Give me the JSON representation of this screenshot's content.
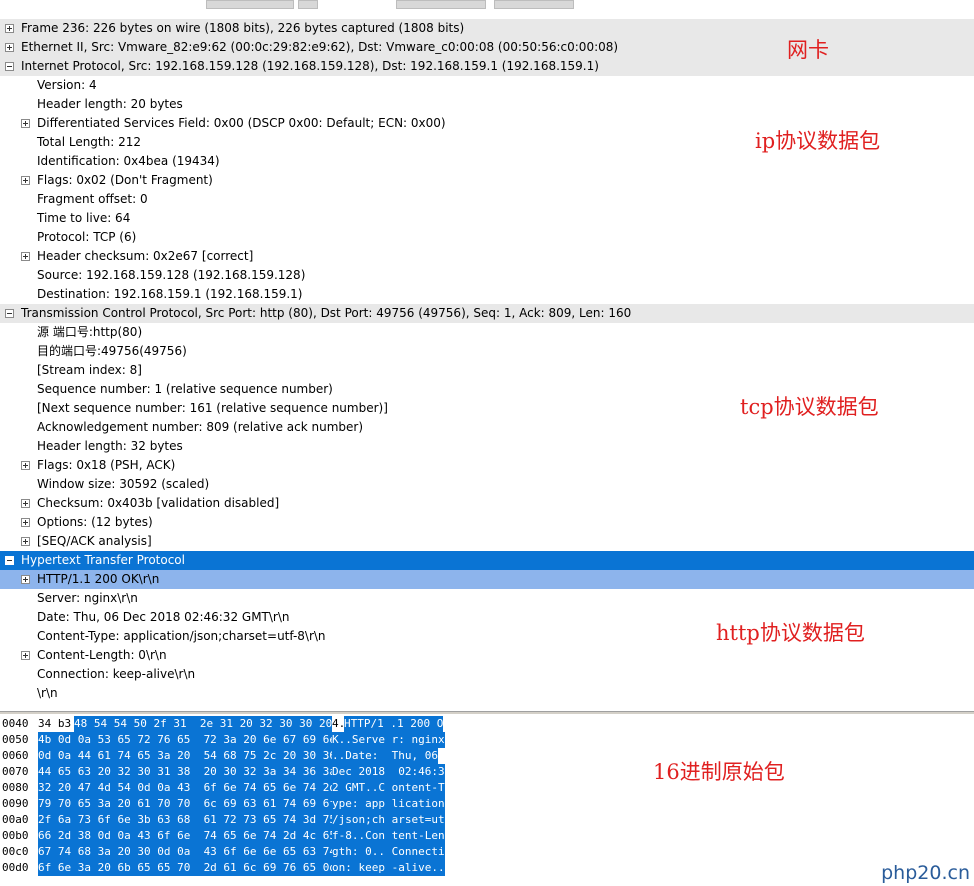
{
  "tree": [
    {
      "text": "Frame 236: 226 bytes on wire (1808 bits), 226 bytes captured (1808 bits)",
      "indent": 0,
      "expander": "plus",
      "style": "hdr"
    },
    {
      "text": "Ethernet II, Src: Vmware_82:e9:62 (00:0c:29:82:e9:62), Dst: Vmware_c0:00:08 (00:50:56:c0:00:08)",
      "indent": 0,
      "expander": "plus",
      "style": "hdr"
    },
    {
      "text": "Internet Protocol, Src: 192.168.159.128 (192.168.159.128), Dst: 192.168.159.1 (192.168.159.1)",
      "indent": 0,
      "expander": "minus",
      "style": "hdr"
    },
    {
      "text": "Version: 4",
      "indent": 1,
      "expander": "none",
      "style": ""
    },
    {
      "text": "Header length: 20 bytes",
      "indent": 1,
      "expander": "none",
      "style": ""
    },
    {
      "text": "Differentiated Services Field: 0x00 (DSCP 0x00: Default; ECN: 0x00)",
      "indent": 1,
      "expander": "plus",
      "style": ""
    },
    {
      "text": "Total Length: 212",
      "indent": 1,
      "expander": "none",
      "style": ""
    },
    {
      "text": "Identification: 0x4bea (19434)",
      "indent": 1,
      "expander": "none",
      "style": ""
    },
    {
      "text": "Flags: 0x02 (Don't Fragment)",
      "indent": 1,
      "expander": "plus",
      "style": ""
    },
    {
      "text": "Fragment offset: 0",
      "indent": 1,
      "expander": "none",
      "style": ""
    },
    {
      "text": "Time to live: 64",
      "indent": 1,
      "expander": "none",
      "style": ""
    },
    {
      "text": "Protocol: TCP (6)",
      "indent": 1,
      "expander": "none",
      "style": ""
    },
    {
      "text": "Header checksum: 0x2e67 [correct]",
      "indent": 1,
      "expander": "plus",
      "style": ""
    },
    {
      "text": "Source: 192.168.159.128 (192.168.159.128)",
      "indent": 1,
      "expander": "none",
      "style": ""
    },
    {
      "text": "Destination: 192.168.159.1 (192.168.159.1)",
      "indent": 1,
      "expander": "none",
      "style": ""
    },
    {
      "text": "Transmission Control Protocol, Src Port: http (80), Dst Port: 49756 (49756), Seq: 1, Ack: 809, Len: 160",
      "indent": 0,
      "expander": "minus",
      "style": "hdr"
    },
    {
      "text": "源  端口号:http(80)",
      "indent": 1,
      "expander": "none",
      "style": ""
    },
    {
      "text": "目的端口号:49756(49756)",
      "indent": 1,
      "expander": "none",
      "style": ""
    },
    {
      "text": "[Stream index: 8]",
      "indent": 1,
      "expander": "none",
      "style": ""
    },
    {
      "text": "Sequence number: 1    (relative sequence number)",
      "indent": 1,
      "expander": "none",
      "style": ""
    },
    {
      "text": "[Next sequence number: 161    (relative sequence number)]",
      "indent": 1,
      "expander": "none",
      "style": ""
    },
    {
      "text": "Acknowledgement number: 809    (relative ack number)",
      "indent": 1,
      "expander": "none",
      "style": ""
    },
    {
      "text": "Header length: 32 bytes",
      "indent": 1,
      "expander": "none",
      "style": ""
    },
    {
      "text": "Flags: 0x18 (PSH, ACK)",
      "indent": 1,
      "expander": "plus",
      "style": ""
    },
    {
      "text": "Window size: 30592 (scaled)",
      "indent": 1,
      "expander": "none",
      "style": ""
    },
    {
      "text": "Checksum: 0x403b [validation disabled]",
      "indent": 1,
      "expander": "plus",
      "style": ""
    },
    {
      "text": "Options: (12 bytes)",
      "indent": 1,
      "expander": "plus",
      "style": ""
    },
    {
      "text": "[SEQ/ACK analysis]",
      "indent": 1,
      "expander": "plus",
      "style": ""
    },
    {
      "text": "Hypertext Transfer Protocol",
      "indent": 0,
      "expander": "minus",
      "style": "sel"
    },
    {
      "text": "HTTP/1.1 200 OK\\r\\n",
      "indent": 1,
      "expander": "plus",
      "style": "hl"
    },
    {
      "text": "Server: nginx\\r\\n",
      "indent": 1,
      "expander": "none",
      "style": ""
    },
    {
      "text": "Date: Thu, 06 Dec 2018 02:46:32 GMT\\r\\n",
      "indent": 1,
      "expander": "none",
      "style": ""
    },
    {
      "text": "Content-Type: application/json;charset=utf-8\\r\\n",
      "indent": 1,
      "expander": "none",
      "style": ""
    },
    {
      "text": "Content-Length: 0\\r\\n",
      "indent": 1,
      "expander": "plus",
      "style": ""
    },
    {
      "text": "Connection: keep-alive\\r\\n",
      "indent": 1,
      "expander": "none",
      "style": ""
    },
    {
      "text": "\\r\\n",
      "indent": 1,
      "expander": "none",
      "style": ""
    }
  ],
  "annotations": {
    "nic": "网卡",
    "ip": "ip协议数据包",
    "tcp": "tcp协议数据包",
    "http": "http协议数据包",
    "hex": "16进制原始包"
  },
  "hex": [
    {
      "offset": "0040",
      "pre": "34 b3",
      "bytes": "48 54 54 50 2f 31  2e 31 20 32 30 30 20 4f",
      "ascii_pre": "4.",
      "ascii": "HTTP/1 .1 200 O"
    },
    {
      "offset": "0050",
      "pre": "",
      "bytes": "4b 0d 0a 53 65 72 76 65  72 3a 20 6e 67 69 6e 78",
      "ascii_pre": "",
      "ascii": "K..Serve r: nginx"
    },
    {
      "offset": "0060",
      "pre": "",
      "bytes": "0d 0a 44 61 74 65 3a 20  54 68 75 2c 20 30 36 20",
      "ascii_pre": "",
      "ascii": "..Date:  Thu, 06"
    },
    {
      "offset": "0070",
      "pre": "",
      "bytes": "44 65 63 20 32 30 31 38  20 30 32 3a 34 36 3a 33",
      "ascii_pre": "",
      "ascii": "Dec 2018  02:46:3"
    },
    {
      "offset": "0080",
      "pre": "",
      "bytes": "32 20 47 4d 54 0d 0a 43  6f 6e 74 65 6e 74 2d 54",
      "ascii_pre": "",
      "ascii": "2 GMT..C ontent-T"
    },
    {
      "offset": "0090",
      "pre": "",
      "bytes": "79 70 65 3a 20 61 70 70  6c 69 63 61 74 69 6f 6e",
      "ascii_pre": "",
      "ascii": "ype: app lication"
    },
    {
      "offset": "00a0",
      "pre": "",
      "bytes": "2f 6a 73 6f 6e 3b 63 68  61 72 73 65 74 3d 75 74",
      "ascii_pre": "",
      "ascii": "/json;ch arset=ut"
    },
    {
      "offset": "00b0",
      "pre": "",
      "bytes": "66 2d 38 0d 0a 43 6f 6e  74 65 6e 74 2d 4c 65 6e",
      "ascii_pre": "",
      "ascii": "f-8..Con tent-Len"
    },
    {
      "offset": "00c0",
      "pre": "",
      "bytes": "67 74 68 3a 20 30 0d 0a  43 6f 6e 6e 65 63 74 69",
      "ascii_pre": "",
      "ascii": "gth: 0.. Connecti"
    },
    {
      "offset": "00d0",
      "pre": "",
      "bytes": "6f 6e 3a 20 6b 65 65 70  2d 61 6c 69 76 65 0d 0a",
      "ascii_pre": "",
      "ascii": "on: keep -alive.."
    }
  ],
  "watermark": "php20.cn",
  "colors": {
    "selection": "#0a74d4",
    "highlight": "#8db4ec",
    "header_row": "#e8e8e8",
    "annotation": "#e02020",
    "watermark": "#2a5c9a"
  }
}
